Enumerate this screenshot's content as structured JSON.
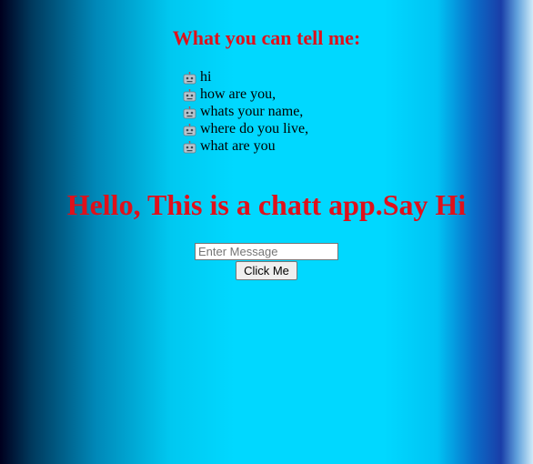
{
  "heading": "What you can tell me:",
  "suggestions": {
    "icon": "robot-face-icon",
    "items": [
      {
        "label": "hi"
      },
      {
        "label": "how are you,"
      },
      {
        "label": "whats your name,"
      },
      {
        "label": "where do you live,"
      },
      {
        "label": "what are you"
      }
    ]
  },
  "greeting": "Hello, This is a chatt app.Say Hi",
  "message_input": {
    "placeholder": "Enter Message",
    "value": ""
  },
  "submit_button": {
    "label": "Click Me"
  },
  "colors": {
    "heading": "#e0101a",
    "background_center": "#00d8ff",
    "background_left": "#00001e"
  }
}
